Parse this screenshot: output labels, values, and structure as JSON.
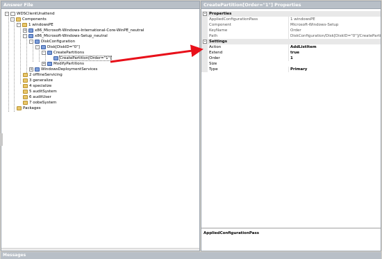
{
  "left_pane": {
    "title": "Answer File",
    "tree": [
      {
        "label": "WDSClientUnattend",
        "icon": "root",
        "expander": "-"
      },
      {
        "label": "Components",
        "icon": "folder",
        "expander": "-"
      },
      {
        "label": "1 windowsPE",
        "icon": "folder",
        "expander": "-"
      },
      {
        "label": "x86_Microsoft-Windows-International-Core-WinPE_neutral",
        "icon": "comp",
        "expander": "+"
      },
      {
        "label": "x86_Microsoft-Windows-Setup_neutral",
        "icon": "comp",
        "expander": "-"
      },
      {
        "label": "DiskConfiguration",
        "icon": "comp",
        "expander": "-"
      },
      {
        "label": "Disk[DiskID=\"0\"]",
        "icon": "comp",
        "expander": "-"
      },
      {
        "label": "CreatePartitions",
        "icon": "comp",
        "expander": "-"
      },
      {
        "label": "CreatePartition[Order=\"1\"]",
        "icon": "comp",
        "expander": "",
        "selected": true
      },
      {
        "label": "ModifyPartitions",
        "icon": "comp",
        "expander": "+"
      },
      {
        "label": "WindowsDeploymentServices",
        "icon": "comp",
        "expander": "+"
      },
      {
        "label": "2 offlineServicing",
        "icon": "folder",
        "expander": ""
      },
      {
        "label": "3 generalize",
        "icon": "folder",
        "expander": ""
      },
      {
        "label": "4 specialize",
        "icon": "folder",
        "expander": ""
      },
      {
        "label": "5 auditSystem",
        "icon": "folder",
        "expander": ""
      },
      {
        "label": "6 auditUser",
        "icon": "folder",
        "expander": ""
      },
      {
        "label": "7 oobeSystem",
        "icon": "folder",
        "expander": ""
      },
      {
        "label": "Packages",
        "icon": "folder",
        "expander": ""
      }
    ]
  },
  "right_pane": {
    "title": "CreatePartition[Order=\"1\"] Properties",
    "categories": [
      {
        "label": "Properties",
        "expander": "-",
        "rows": [
          {
            "name": "AppliedConfigurationPass",
            "value": "1 windowsPE",
            "editable": false
          },
          {
            "name": "Component",
            "value": "Microsoft-Windows-Setup",
            "editable": false
          },
          {
            "name": "KeyName",
            "value": "Order",
            "editable": false
          },
          {
            "name": "Path",
            "value": "DiskConfiguration/Disk[DiskID=\"0\"]/CreatePartitions/Cre",
            "editable": false
          }
        ]
      },
      {
        "label": "Settings",
        "expander": "-",
        "rows": [
          {
            "name": "Action",
            "value": "AddListItem",
            "editable": true
          },
          {
            "name": "Extend",
            "value": "true",
            "editable": true
          },
          {
            "name": "Order",
            "value": "1",
            "editable": true
          },
          {
            "name": "Size",
            "value": "",
            "editable": true
          },
          {
            "name": "Type",
            "value": "Primary",
            "editable": true
          }
        ]
      }
    ],
    "description": "AppliedConfigurationPass"
  },
  "bottom_bar": {
    "title": "Messages"
  },
  "annotation": {
    "arrow_color": "#e8101a"
  }
}
